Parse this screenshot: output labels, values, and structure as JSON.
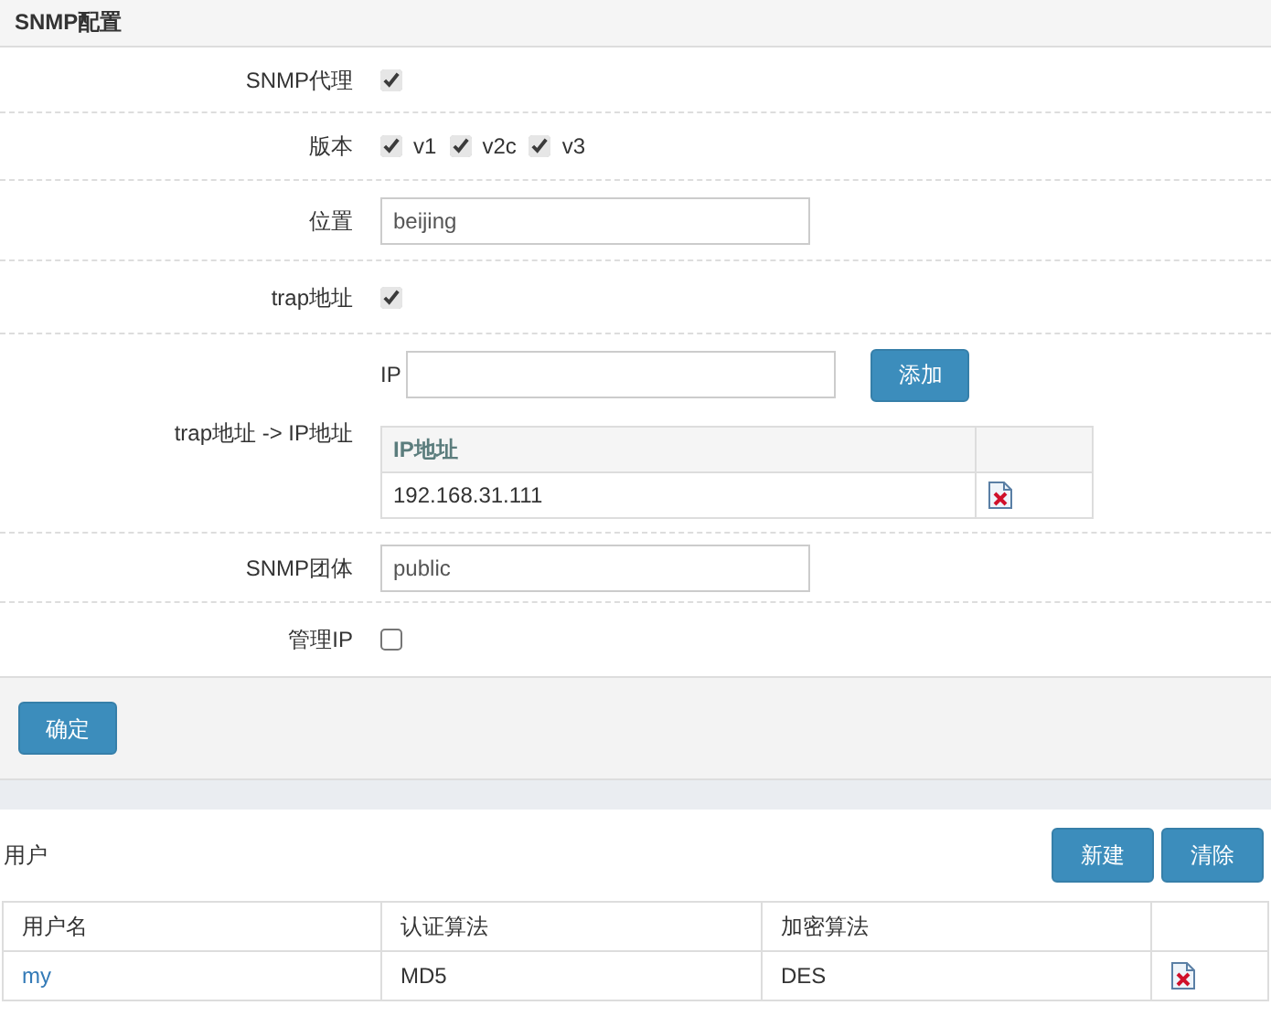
{
  "panel_title": "SNMP配置",
  "fields": [
    {
      "kind": "checkbox",
      "label": "SNMP代理",
      "checked": true
    },
    {
      "kind": "checkgroup",
      "label": "版本",
      "options": [
        {
          "label": "v1",
          "checked": true
        },
        {
          "label": "v2c",
          "checked": true
        },
        {
          "label": "v3",
          "checked": true
        }
      ]
    },
    {
      "kind": "text",
      "label": "位置",
      "value": "beijing"
    },
    {
      "kind": "checkbox",
      "label": "trap地址",
      "checked": true
    },
    {
      "kind": "ip_list",
      "label": "trap地址 -> IP地址",
      "input_label": "IP",
      "add_button": "添加",
      "column": "IP地址",
      "rows": [
        "192.168.31.111"
      ]
    },
    {
      "kind": "text",
      "label": "SNMP团体",
      "value": "public"
    },
    {
      "kind": "checkbox",
      "label": "管理IP",
      "checked": false
    }
  ],
  "submit_button": "确定",
  "users": {
    "title": "用户",
    "buttons": [
      "新建",
      "清除"
    ],
    "columns": [
      "用户名",
      "认证算法",
      "加密算法"
    ],
    "rows": [
      [
        "my",
        "MD5",
        "DES"
      ]
    ]
  }
}
